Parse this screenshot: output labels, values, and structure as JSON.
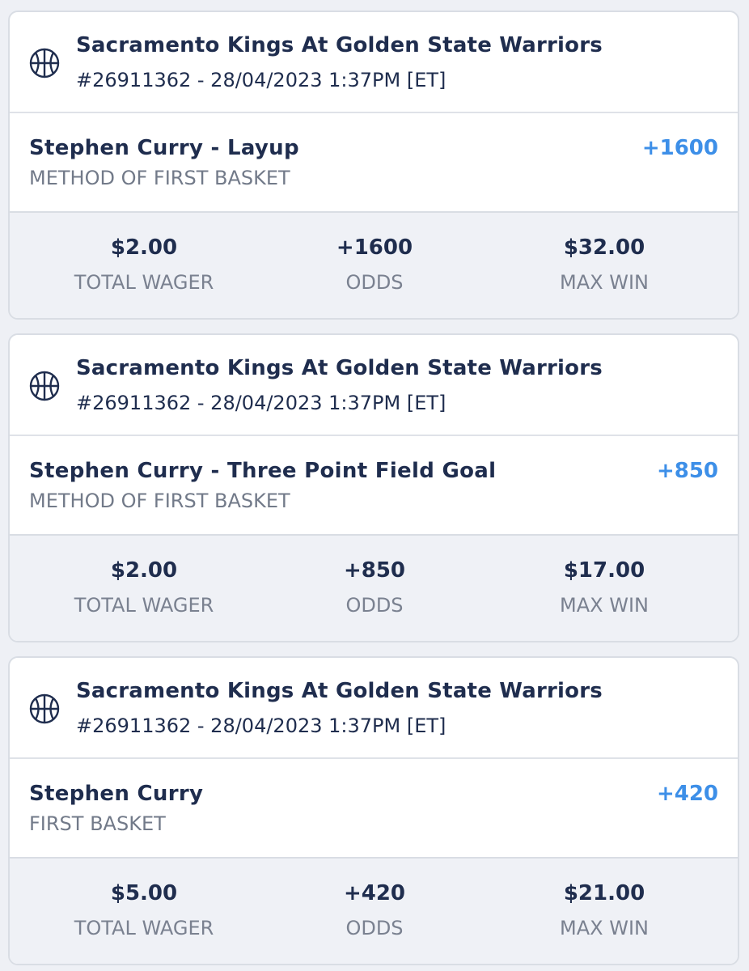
{
  "bets": [
    {
      "event": "Sacramento Kings At Golden State Warriors",
      "meta": "#26911362 - 28/04/2023 1:37PM [ET]",
      "icon": "basketball-icon",
      "selection": "Stephen Curry - Layup",
      "market": "METHOD OF FIRST BASKET",
      "odds": "+1600",
      "total_wager": "$2.00",
      "total_wager_label": "TOTAL WAGER",
      "odds_value": "+1600",
      "odds_label": "ODDS",
      "max_win": "$32.00",
      "max_win_label": "MAX WIN"
    },
    {
      "event": "Sacramento Kings At Golden State Warriors",
      "meta": "#26911362 - 28/04/2023 1:37PM [ET]",
      "icon": "basketball-icon",
      "selection": "Stephen Curry - Three Point Field Goal",
      "market": "METHOD OF FIRST BASKET",
      "odds": "+850",
      "total_wager": "$2.00",
      "total_wager_label": "TOTAL WAGER",
      "odds_value": "+850",
      "odds_label": "ODDS",
      "max_win": "$17.00",
      "max_win_label": "MAX WIN"
    },
    {
      "event": "Sacramento Kings At Golden State Warriors",
      "meta": "#26911362 - 28/04/2023 1:37PM [ET]",
      "icon": "basketball-icon",
      "selection": "Stephen Curry",
      "market": "FIRST BASKET",
      "odds": "+420",
      "total_wager": "$5.00",
      "total_wager_label": "TOTAL WAGER",
      "odds_value": "+420",
      "odds_label": "ODDS",
      "max_win": "$21.00",
      "max_win_label": "MAX WIN"
    }
  ],
  "colors": {
    "navy_text": "#1f2d4e",
    "odds_blue": "#3d8fe8",
    "muted_gray": "#727a89",
    "summary_bg": "#eff1f6",
    "page_bg": "#eef0f5"
  }
}
